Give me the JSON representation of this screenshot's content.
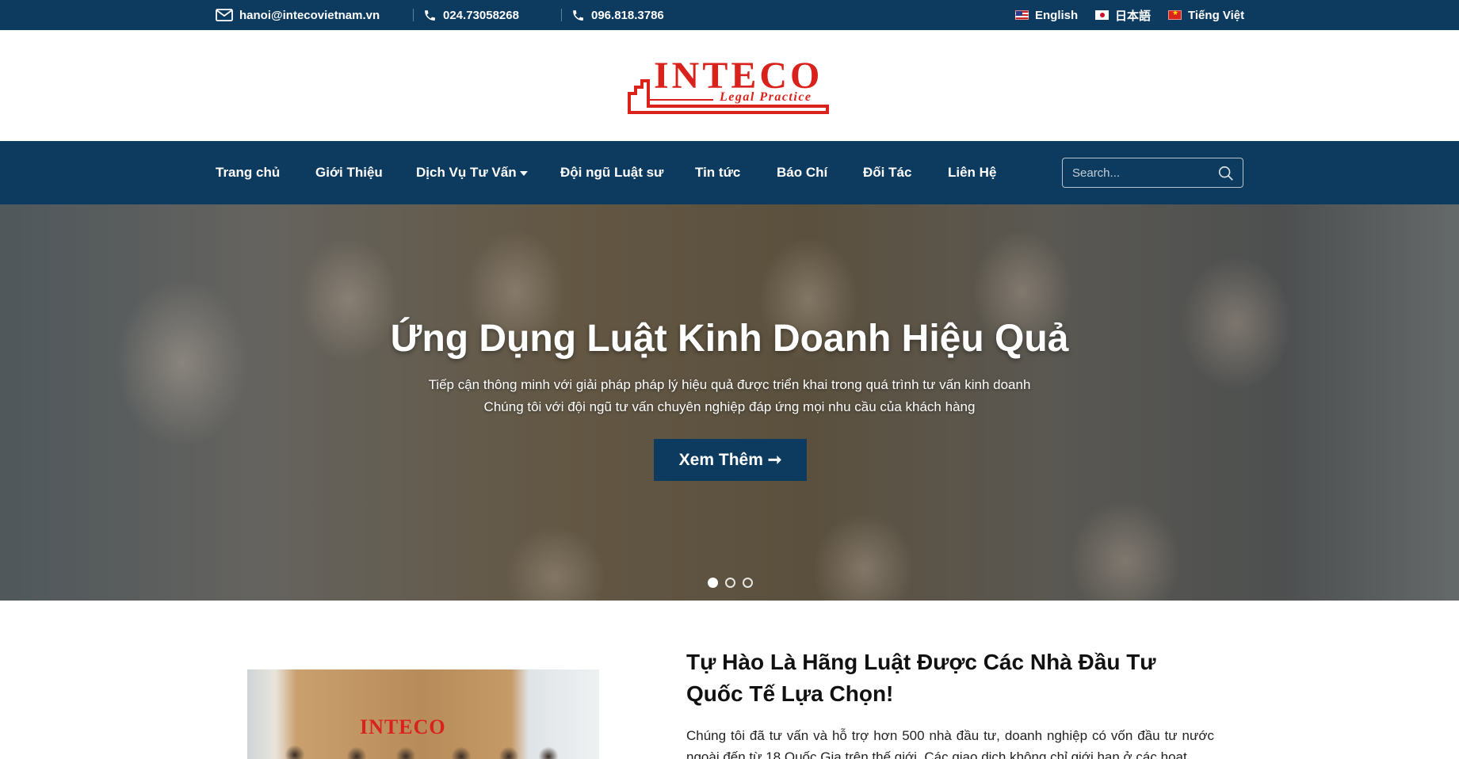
{
  "topbar": {
    "email": "hanoi@intecovietnam.vn",
    "phone1": "024.73058268",
    "phone2": "096.818.3786",
    "languages": [
      {
        "label": "English",
        "flag": "us-flag-icon"
      },
      {
        "label": "日本語",
        "flag": "jp-flag-icon"
      },
      {
        "label": "Tiếng Việt",
        "flag": "vn-flag-icon"
      }
    ]
  },
  "logo": {
    "brand": "INTECO",
    "tagline": "Legal Practice",
    "color": "#d9221c"
  },
  "nav": {
    "items": [
      {
        "label": "Trang chủ"
      },
      {
        "label": "Giới Thiệu"
      },
      {
        "label": "Dịch Vụ Tư Vấn",
        "dropdown": true
      },
      {
        "label": "Đội ngũ Luật sư"
      },
      {
        "label": "Tin tức"
      },
      {
        "label": "Báo Chí"
      },
      {
        "label": "Đối Tác"
      },
      {
        "label": "Liên Hệ"
      }
    ],
    "search_placeholder": "Search..."
  },
  "hero": {
    "title": "Ứng Dụng Luật Kinh Doanh Hiệu Quả",
    "subtitle_line1": "Tiếp cận thông minh với giải pháp pháp lý hiệu quả được triển khai trong quá trình tư vấn kinh doanh",
    "subtitle_line2": "Chúng tôi với đội ngũ tư vấn chuyên nghiệp đáp ứng mọi nhu cầu của khách hàng",
    "button_label": "Xem Thêm ➞",
    "slides_total": 3,
    "slide_active": 1
  },
  "about": {
    "image_logo_text": "INTECO",
    "title": "Tự Hào Là Hãng Luật Được Các Nhà Đầu Tư Quốc Tế Lựa Chọn!",
    "text": "Chúng tôi đã tư vấn và hỗ trợ hơn 500 nhà đầu tư, doanh nghiệp có vốn đầu tư nước ngoài đến từ 18 Quốc Gia trên thế giới. Các giao dịch không chỉ giới hạn ở các hoạt"
  },
  "colors": {
    "primary": "#0d3b5f",
    "accent": "#d9221c"
  }
}
